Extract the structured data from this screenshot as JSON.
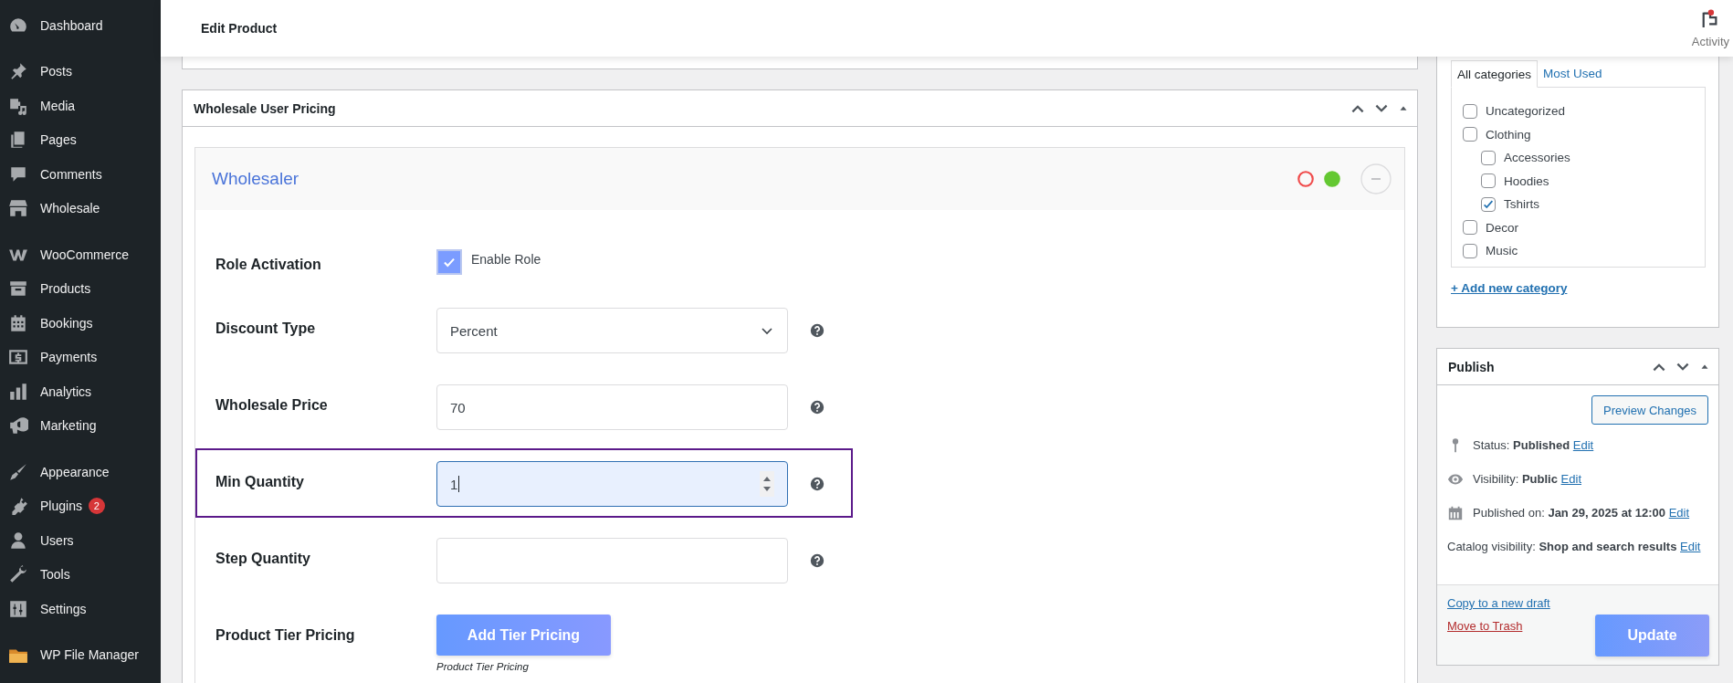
{
  "topbar": {
    "title": "Edit Product",
    "activity": {
      "label": "Activity",
      "notification": true
    }
  },
  "sidebar": {
    "groups": [
      {
        "items": [
          {
            "label": "Dashboard"
          }
        ]
      },
      {
        "items": [
          {
            "label": "Posts"
          },
          {
            "label": "Media"
          },
          {
            "label": "Pages"
          },
          {
            "label": "Comments"
          },
          {
            "label": "Wholesale"
          }
        ]
      },
      {
        "items": [
          {
            "label": "WooCommerce"
          },
          {
            "label": "Products"
          },
          {
            "label": "Bookings"
          },
          {
            "label": "Payments"
          },
          {
            "label": "Analytics"
          },
          {
            "label": "Marketing"
          }
        ]
      },
      {
        "items": [
          {
            "label": "Appearance"
          },
          {
            "label": "Plugins",
            "badge": "2"
          },
          {
            "label": "Users"
          },
          {
            "label": "Tools"
          },
          {
            "label": "Settings"
          }
        ]
      },
      {
        "items": [
          {
            "label": "WP File Manager"
          }
        ]
      }
    ]
  },
  "wholesale_pricing": {
    "title": "Wholesale User Pricing",
    "role": {
      "name": "Wholesaler",
      "status_dots": [
        {
          "color": "#f04b4b",
          "filled": false
        },
        {
          "color": "#64c832",
          "filled": true
        }
      ]
    },
    "fields": [
      {
        "kind": "checkbox",
        "label": "Role Activation",
        "option": "Enable Role",
        "checked": true
      },
      {
        "kind": "select",
        "label": "Discount Type",
        "value": "Percent",
        "focused": false
      },
      {
        "kind": "input",
        "label": "Wholesale Price",
        "value": "70",
        "focused": false
      },
      {
        "kind": "number",
        "label": "Min Quantity",
        "value": "1",
        "focused": true
      },
      {
        "kind": "input",
        "label": "Step Quantity",
        "focused": false
      },
      {
        "kind": "button",
        "label": "Product Tier Pricing",
        "button": "Add Tier Pricing",
        "caption": "Product Tier Pricing"
      }
    ]
  },
  "categories": {
    "tabs": [
      {
        "label": "All categories",
        "selected": true
      },
      {
        "label": "Most Used",
        "selected": false
      }
    ],
    "items": [
      {
        "label": "Uncategorized",
        "checked": false
      },
      {
        "label": "Clothing",
        "checked": false,
        "children": [
          {
            "label": "Accessories",
            "checked": false
          },
          {
            "label": "Hoodies",
            "checked": false
          },
          {
            "label": "Tshirts",
            "checked": true
          }
        ]
      },
      {
        "label": "Decor",
        "checked": false
      },
      {
        "label": "Music",
        "checked": false
      }
    ],
    "add_link": "+ Add new category"
  },
  "publish": {
    "title": "Publish",
    "preview_button": "Preview Changes",
    "rows": [
      {
        "kind": "status",
        "text": "Status: **Published**",
        "link": "Edit"
      },
      {
        "kind": "visibility",
        "text": "Visibility: **Public**",
        "link": "Edit"
      },
      {
        "kind": "date",
        "text": "Published on: **Jan 29, 2025 at 12:00**",
        "link": "Edit"
      },
      {
        "kind": "catalog",
        "text": "Catalog visibility: **Shop and search results**",
        "link": "Edit"
      }
    ],
    "copy_link": "Copy to a new draft",
    "trash_link": "Move to Trash",
    "update_button": "Update"
  }
}
